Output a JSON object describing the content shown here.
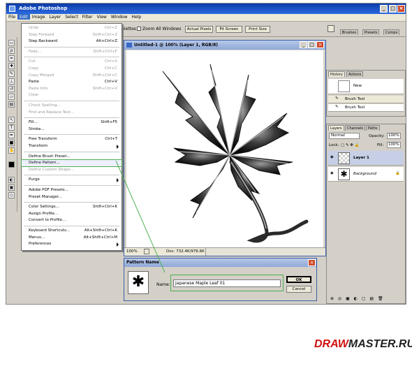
{
  "app": {
    "title": "Adobe Photoshop",
    "min": "_",
    "max": "□",
    "close": "×"
  },
  "menubar": [
    "File",
    "Edit",
    "Image",
    "Layer",
    "Select",
    "Filter",
    "View",
    "Window",
    "Help"
  ],
  "options": {
    "palettes_label": "Palettes",
    "zoom_all": "Zoom All Windows",
    "actual_pixels": "Actual Pixels",
    "fit_screen": "Fit Screen",
    "print_size": "Print Size",
    "tabs": [
      "Brushes",
      "Presets",
      "Comps"
    ]
  },
  "edit_menu": [
    {
      "label": "Undo",
      "shortcut": "Ctrl+Z",
      "disabled": true
    },
    {
      "label": "Step Forward",
      "shortcut": "Shift+Ctrl+Z",
      "disabled": true
    },
    {
      "label": "Step Backward",
      "shortcut": "Alt+Ctrl+Z",
      "disabled": false
    },
    {
      "sep": true
    },
    {
      "label": "Fade...",
      "shortcut": "Shift+Ctrl+F",
      "disabled": true
    },
    {
      "sep": true
    },
    {
      "label": "Cut",
      "shortcut": "Ctrl+X",
      "disabled": true
    },
    {
      "label": "Copy",
      "shortcut": "Ctrl+C",
      "disabled": true
    },
    {
      "label": "Copy Merged",
      "shortcut": "Shift+Ctrl+C",
      "disabled": true
    },
    {
      "label": "Paste",
      "shortcut": "Ctrl+V",
      "disabled": false
    },
    {
      "label": "Paste Into",
      "shortcut": "Shift+Ctrl+V",
      "disabled": true
    },
    {
      "label": "Clear",
      "shortcut": "",
      "disabled": true
    },
    {
      "sep": true
    },
    {
      "label": "Check Spelling...",
      "shortcut": "",
      "disabled": true
    },
    {
      "label": "Find and Replace Text...",
      "shortcut": "",
      "disabled": true
    },
    {
      "sep": true
    },
    {
      "label": "Fill...",
      "shortcut": "Shift+F5",
      "disabled": false
    },
    {
      "label": "Stroke...",
      "shortcut": "",
      "disabled": false
    },
    {
      "sep": true
    },
    {
      "label": "Free Transform",
      "shortcut": "Ctrl+T",
      "disabled": false
    },
    {
      "label": "Transform",
      "shortcut": "",
      "disabled": false,
      "submenu": true
    },
    {
      "sep": true
    },
    {
      "label": "Define Brush Preset...",
      "shortcut": "",
      "disabled": false
    },
    {
      "label": "Define Pattern...",
      "shortcut": "",
      "disabled": false,
      "highlight": true
    },
    {
      "label": "Define Custom Shape...",
      "shortcut": "",
      "disabled": true
    },
    {
      "sep": true
    },
    {
      "label": "Purge",
      "shortcut": "",
      "disabled": false,
      "submenu": true
    },
    {
      "sep": true
    },
    {
      "label": "Adobe PDF Presets...",
      "shortcut": "",
      "disabled": false
    },
    {
      "label": "Preset Manager...",
      "shortcut": "",
      "disabled": false
    },
    {
      "sep": true
    },
    {
      "label": "Color Settings...",
      "shortcut": "Shift+Ctrl+K",
      "disabled": false
    },
    {
      "label": "Assign Profile...",
      "shortcut": "",
      "disabled": false
    },
    {
      "label": "Convert to Profile...",
      "shortcut": "",
      "disabled": false
    },
    {
      "sep": true
    },
    {
      "label": "Keyboard Shortcuts...",
      "shortcut": "Alt+Shift+Ctrl+K",
      "disabled": false
    },
    {
      "label": "Menus...",
      "shortcut": "Alt+Shift+Ctrl+M",
      "disabled": false
    },
    {
      "label": "Preferences",
      "shortcut": "",
      "disabled": false,
      "submenu": true
    }
  ],
  "document": {
    "title": "Untitled-1 @ 100% (Layer 1, RGB/8)",
    "zoom": "100%",
    "doc_info": "Doc: 732.4K/976.6K"
  },
  "history": {
    "tabs": [
      "History",
      "Actions"
    ],
    "items": [
      "New",
      "Brush Tool",
      "Brush Tool"
    ]
  },
  "layers": {
    "tabs": [
      "Layers",
      "Channels",
      "Paths"
    ],
    "blend_mode": "Normal",
    "opacity_label": "Opacity:",
    "opacity": "100%",
    "lock_label": "Lock:",
    "fill_label": "Fill:",
    "fill": "100%",
    "items": [
      "Layer 1",
      "Background"
    ]
  },
  "dialog": {
    "title": "Pattern Name",
    "name_label": "Name:",
    "name_value": "Japanese Maple Leaf 01",
    "ok": "OK",
    "cancel": "Cancel",
    "close": "×"
  },
  "watermark": {
    "part1": "DRAW",
    "part2": "MASTER.RU"
  },
  "colors": {
    "accent": "#316ac5",
    "highlight": "#4caf50",
    "brand": "#d01010"
  }
}
